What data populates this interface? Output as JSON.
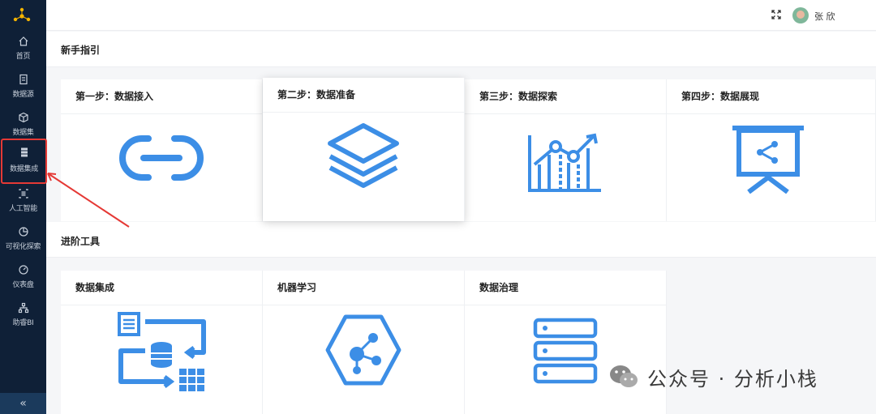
{
  "sidebar": {
    "items": [
      {
        "label": "首页",
        "icon": "home-icon"
      },
      {
        "label": "数据源",
        "icon": "datasource-icon"
      },
      {
        "label": "数据集",
        "icon": "cube-icon"
      },
      {
        "label": "数据集成",
        "icon": "server-icon"
      },
      {
        "label": "人工智能",
        "icon": "ai-icon"
      },
      {
        "label": "可视化探索",
        "icon": "pie-chart-icon"
      },
      {
        "label": "仪表盘",
        "icon": "gauge-icon"
      },
      {
        "label": "助睿BI",
        "icon": "org-chart-icon"
      }
    ],
    "active_index": 3,
    "collapse_label": "«"
  },
  "header": {
    "username": "张  欣"
  },
  "guide": {
    "title": "新手指引",
    "cards": [
      {
        "label": "第一步：数据接入",
        "icon": "link-icon"
      },
      {
        "label": "第二步：数据准备",
        "icon": "layers-icon"
      },
      {
        "label": "第三步：数据探索",
        "icon": "trend-chart-icon"
      },
      {
        "label": "第四步：数据展现",
        "icon": "presentation-icon"
      }
    ]
  },
  "advanced": {
    "title": "进阶工具",
    "cards": [
      {
        "label": "数据集成",
        "icon": "data-integration-icon"
      },
      {
        "label": "机器学习",
        "icon": "machine-learning-icon"
      },
      {
        "label": "数据治理",
        "icon": "data-governance-icon"
      }
    ]
  },
  "watermark": {
    "text": "公众号 · 分析小栈"
  },
  "colors": {
    "sidebar_bg": "#0f2037",
    "accent_blue": "#3c8ee6",
    "highlight_red": "#e53935"
  }
}
